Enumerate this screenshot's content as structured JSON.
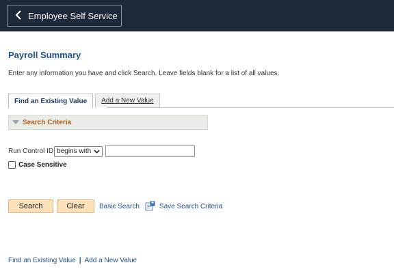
{
  "header": {
    "back_label": "Employee Self Service"
  },
  "page": {
    "title": "Payroll Summary",
    "instructions": "Enter any information you have and click Search. Leave fields blank for a list of all values."
  },
  "tabs": [
    {
      "label": "Find an Existing Value",
      "active": true
    },
    {
      "label": "Add a New Value",
      "active": false
    }
  ],
  "search_criteria": {
    "heading": "Search Criteria",
    "field_label": "Run Control ID",
    "operator": "begins with",
    "value": "",
    "case_sensitive_label": "Case Sensitive",
    "case_sensitive_checked": false
  },
  "actions": {
    "search_label": "Search",
    "clear_label": "Clear",
    "basic_search_label": "Basic Search",
    "save_search_label": "Save Search Criteria"
  },
  "footer": {
    "find_existing_label": "Find an Existing Value",
    "add_new_label": "Add a New Value"
  },
  "colors": {
    "header_bg": "#1c2a3a",
    "title_blue": "#1f4f8b",
    "section_orange": "#b35a18",
    "button_bg": "#fbe0b9"
  }
}
